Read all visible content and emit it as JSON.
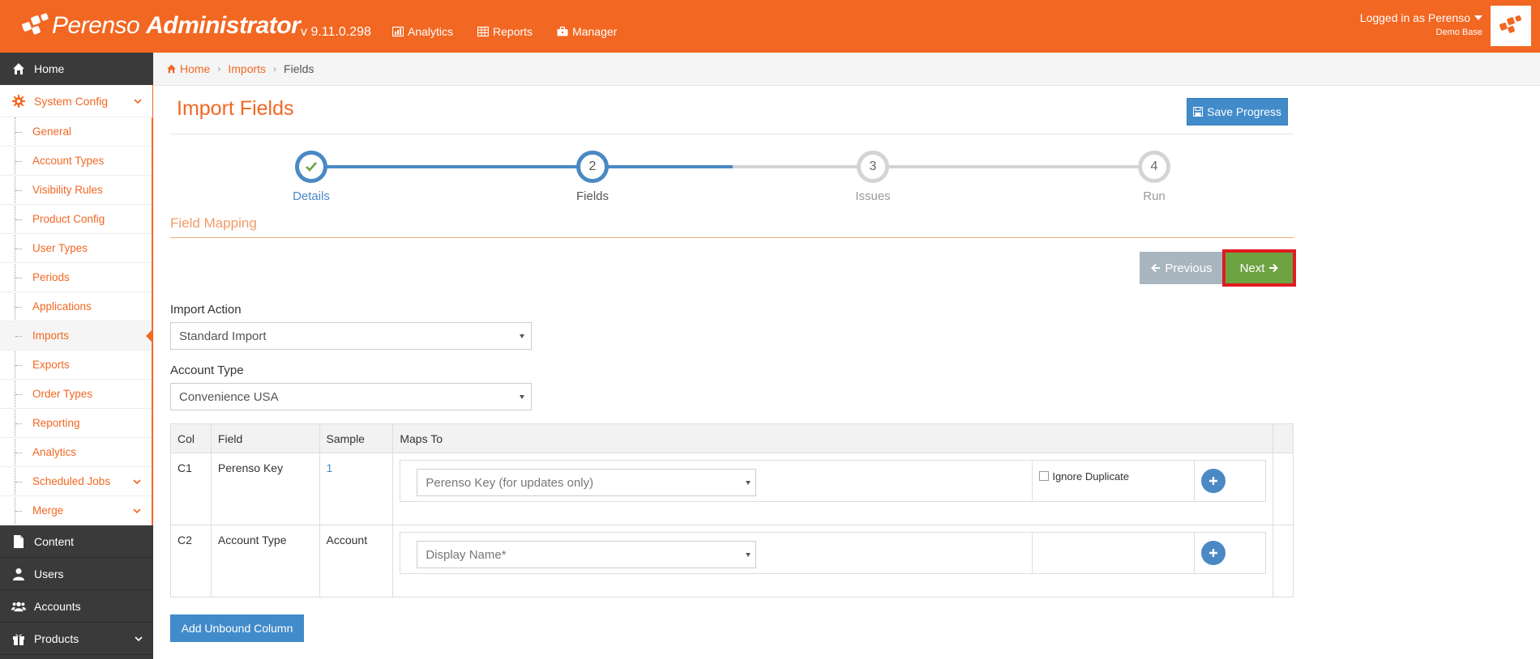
{
  "header": {
    "brand_name": "Perenso",
    "brand_suffix": "Administrator",
    "version": "v 9.11.0.298",
    "nav": [
      {
        "label": "Analytics",
        "icon": "bar-chart-icon"
      },
      {
        "label": "Reports",
        "icon": "table-icon"
      },
      {
        "label": "Manager",
        "icon": "briefcase-icon"
      }
    ],
    "user_line": "Logged in as Perenso",
    "user_db": "Demo Base"
  },
  "sidebar": {
    "home": "Home",
    "system_config": "System Config",
    "sub_items": [
      "General",
      "Account Types",
      "Visibility Rules",
      "Product Config",
      "User Types",
      "Periods",
      "Applications",
      "Imports",
      "Exports",
      "Order Types",
      "Reporting",
      "Analytics",
      "Scheduled Jobs",
      "Merge"
    ],
    "current_sub": "Imports",
    "bottom_items": [
      "Content",
      "Users",
      "Accounts",
      "Products"
    ]
  },
  "breadcrumb": {
    "home": "Home",
    "imports": "Imports",
    "current": "Fields"
  },
  "page": {
    "title": "Import Fields",
    "save_label": "Save Progress",
    "steps": [
      {
        "number": "1",
        "label": "Details",
        "state": "done"
      },
      {
        "number": "2",
        "label": "Fields",
        "state": "current"
      },
      {
        "number": "3",
        "label": "Issues",
        "state": "pending"
      },
      {
        "number": "4",
        "label": "Run",
        "state": "pending"
      }
    ],
    "section_title": "Field Mapping",
    "prev_label": "Previous",
    "next_label": "Next",
    "import_action_label": "Import Action",
    "import_action_value": "Standard Import",
    "account_type_label": "Account Type",
    "account_type_value": "Convenience USA",
    "table": {
      "headers": [
        "Col",
        "Field",
        "Sample",
        "Maps To"
      ],
      "rows": [
        {
          "col": "C1",
          "field": "Perenso Key",
          "sample": "1",
          "maps_to": "Perenso Key (for updates only)",
          "ignore_duplicate": "Ignore Duplicate"
        },
        {
          "col": "C2",
          "field": "Account Type",
          "sample": "Account",
          "maps_to": "Display Name*",
          "ignore_duplicate": ""
        }
      ]
    },
    "unbound_label": "Add Unbound Column"
  },
  "colors": {
    "brand_orange": "#f26722",
    "primary_blue": "#428bca",
    "next_green": "#6ea341",
    "highlight_red": "#e11b22"
  }
}
